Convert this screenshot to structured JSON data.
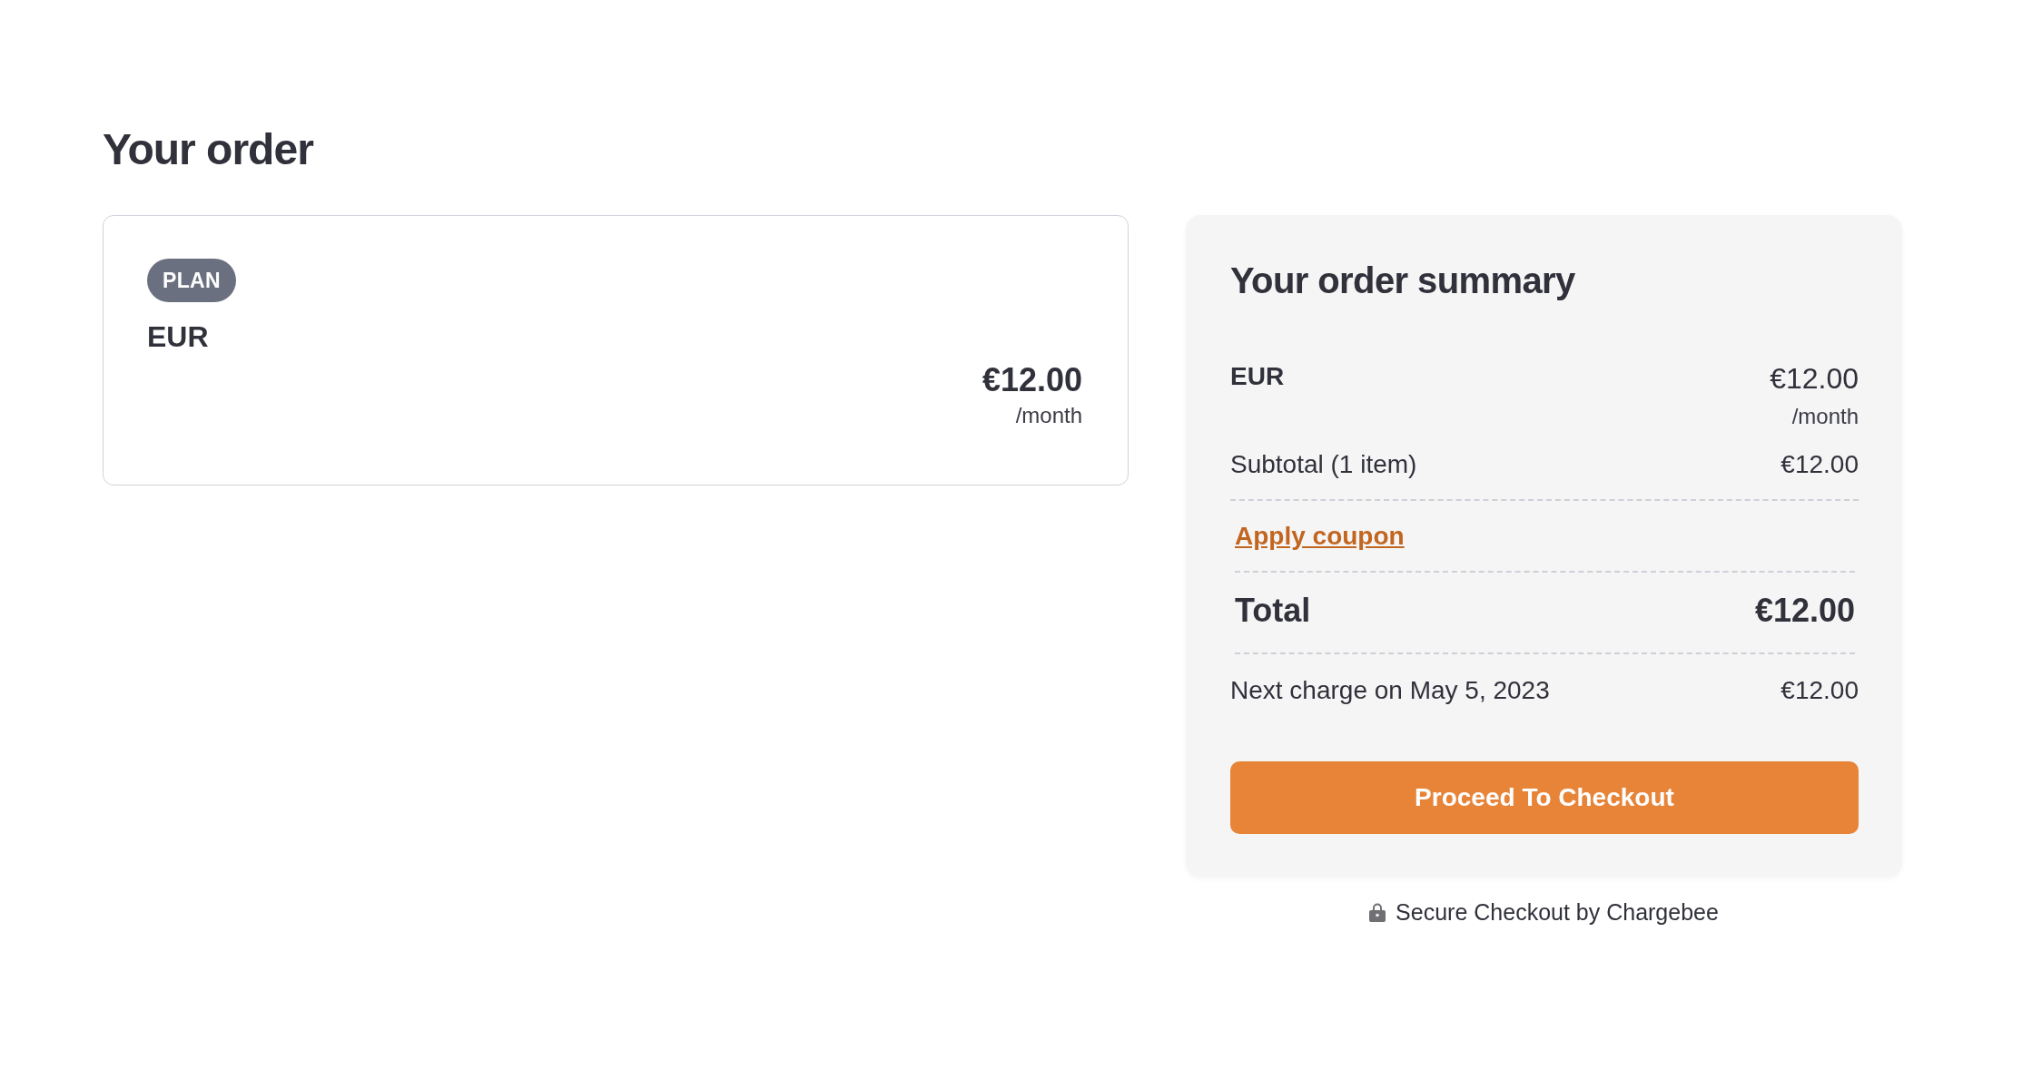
{
  "title": "Your order",
  "plan_card": {
    "badge": "PLAN",
    "name": "EUR",
    "price": "€12.00",
    "period": "/month"
  },
  "summary": {
    "title": "Your order summary",
    "item": {
      "name": "EUR",
      "price": "€12.00",
      "period": "/month"
    },
    "subtotal": {
      "label": "Subtotal (1 item)",
      "amount": "€12.00"
    },
    "coupon_link": "Apply coupon",
    "total": {
      "label": "Total",
      "amount": "€12.00"
    },
    "next_charge": {
      "label": "Next charge on May 5, 2023",
      "amount": "€12.00"
    },
    "checkout_button": "Proceed To Checkout"
  },
  "footer": {
    "secure_text": "Secure Checkout by Chargebee"
  }
}
